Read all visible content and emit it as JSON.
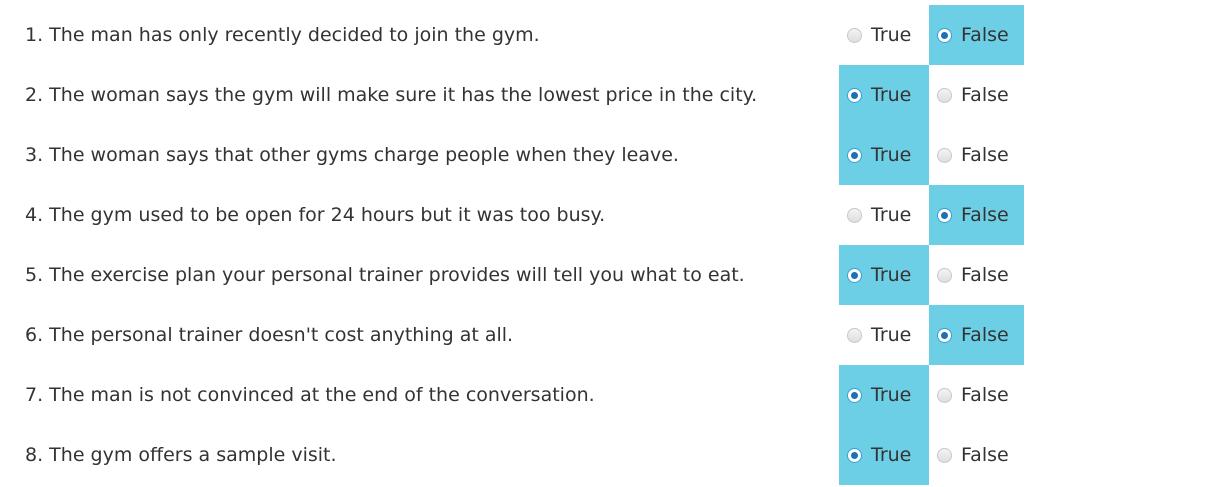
{
  "questions": [
    {
      "text": "1. The man has only recently decided to join the gym.",
      "selected": "false"
    },
    {
      "text": "2. The woman says the gym will make sure it has the lowest price in the city.",
      "selected": "true"
    },
    {
      "text": "3. The woman says that other gyms charge people when they leave.",
      "selected": "true"
    },
    {
      "text": "4. The gym used to be open for 24 hours but it was too busy.",
      "selected": "false"
    },
    {
      "text": "5. The exercise plan your personal trainer provides will tell you what to eat.",
      "selected": "true"
    },
    {
      "text": "6. The personal trainer doesn't cost anything at all.",
      "selected": "false"
    },
    {
      "text": "7. The man is not convinced at the end of the conversation.",
      "selected": "true"
    },
    {
      "text": "8. The gym offers a sample visit.",
      "selected": "true"
    }
  ],
  "options": {
    "true_label": "True",
    "false_label": "False"
  },
  "colors": {
    "selected_bg": "#6dcfe6",
    "text": "#333333"
  }
}
